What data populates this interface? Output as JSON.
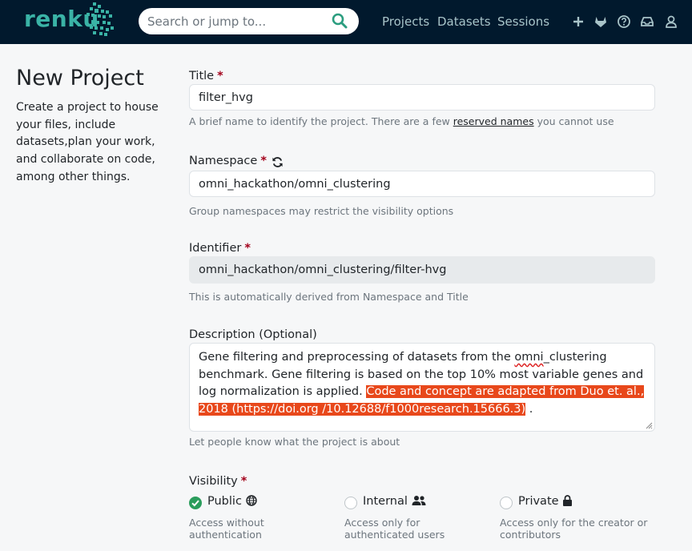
{
  "app": {
    "logo_text": "renku",
    "brand_color": "#3ab3a6",
    "header_bg": "#01192d"
  },
  "header": {
    "search_placeholder": "Search or jump to...",
    "nav": [
      "Projects",
      "Datasets",
      "Sessions"
    ],
    "icons": [
      "plus-icon",
      "gitlab-icon",
      "help-icon",
      "inbox-icon",
      "user-icon"
    ]
  },
  "page": {
    "title": "New Project",
    "intro": "Create a project to house your files, include datasets,plan your work, and collaborate on code, among other things."
  },
  "form": {
    "required_mark": "*",
    "title": {
      "label": "Title",
      "value": "filter_hvg",
      "help_before": "A brief name to identify the project. There are a few ",
      "help_link": "reserved names",
      "help_after": " you cannot use"
    },
    "namespace": {
      "label": "Namespace",
      "value": "omni_hackathon/omni_clustering",
      "help": "Group namespaces may restrict the visibility options"
    },
    "identifier": {
      "label": "Identifier",
      "value": "omni_hackathon/omni_clustering/filter-hvg",
      "help": "This is automatically derived from Namespace and Title"
    },
    "description": {
      "label": "Description (Optional)",
      "text_part1": "Gene filtering and preprocessing of datasets from the ",
      "text_misspelled": "omni",
      "text_part2": "_clustering benchmark. Gene filtering is based on the top 10% most variable genes and log normalization is applied. ",
      "text_selected": "Code and concept are adapted from Duo et. al., 2018 (https://doi.org /10.12688/f1000research.15666.3)",
      "text_part3": " .",
      "help": "Let people know what the project is about"
    },
    "visibility": {
      "label": "Visibility",
      "options": [
        {
          "label": "Public",
          "help": "Access without authentication",
          "checked": true
        },
        {
          "label": "Internal",
          "help": "Access only for authenticated users",
          "checked": false
        },
        {
          "label": "Private",
          "help": "Access only for the creator or contributors",
          "checked": false
        }
      ]
    }
  }
}
